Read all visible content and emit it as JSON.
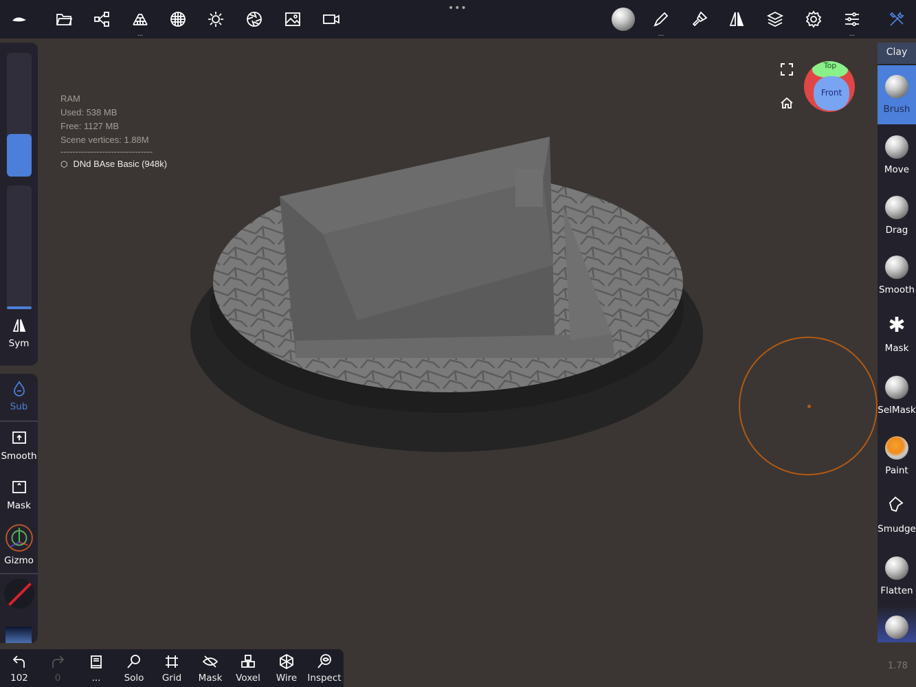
{
  "topbar": {
    "left_icons": [
      "nomad-logo-icon",
      "folder-icon",
      "scene-graph-icon",
      "topology-icon",
      "material-sphere-icon",
      "light-icon",
      "camera-aperture-icon",
      "image-icon",
      "video-icon"
    ],
    "right_icons": [
      "brush-preview-icon",
      "stroke-icon",
      "paint-brush-icon",
      "symmetry-icon",
      "layers-icon",
      "settings-icon",
      "sliders-icon",
      "tools-icon"
    ],
    "more": "•••"
  },
  "info": {
    "ram": "RAM",
    "used": "Used:  538 MB",
    "free": "Free:  1127 MB",
    "vertices": "Scene vertices:  1.88M",
    "separator": "-------------------------------",
    "object": "DNd BAse Basic (948k)"
  },
  "gizmo_cube": {
    "top": "Top",
    "front": "Front"
  },
  "left": {
    "sym": "Sym",
    "sub": "Sub",
    "smooth": "Smooth",
    "mask": "Mask",
    "gizmo": "Gizmo",
    "radius_level": 0.35,
    "intensity_level": 0.02
  },
  "right": {
    "title": "Clay",
    "tools": [
      "Brush",
      "Move",
      "Drag",
      "Smooth",
      "Mask",
      "SelMask",
      "Paint",
      "Smudge",
      "Flatten"
    ],
    "active": "Brush"
  },
  "bottom": {
    "undo": "102",
    "redo": "0",
    "more": "...",
    "solo": "Solo",
    "grid": "Grid",
    "mask": "Mask",
    "voxel": "Voxel",
    "wire": "Wire",
    "inspect": "Inspect"
  },
  "version": "1.78",
  "colors": {
    "accent": "#4b7fd9",
    "cursor": "#b35a14",
    "toolbar": "#1d1d27",
    "viewport": "#3b3633"
  }
}
